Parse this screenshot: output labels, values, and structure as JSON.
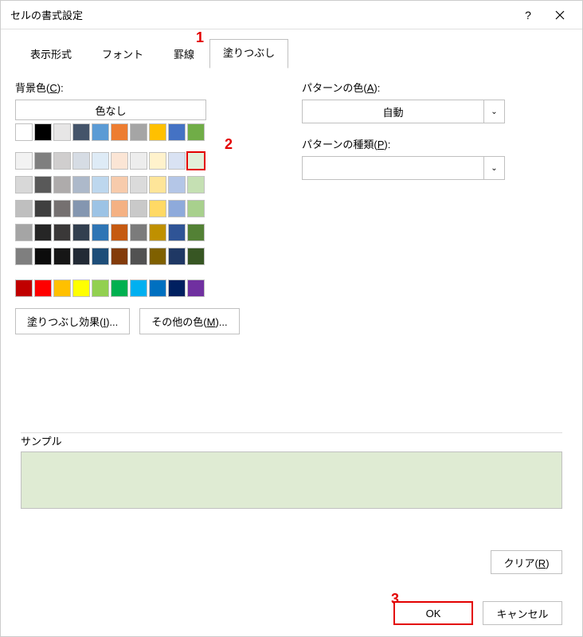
{
  "dialog": {
    "title": "セルの書式設定"
  },
  "tabs": {
    "display_format": "表示形式",
    "font": "フォント",
    "border": "罫線",
    "fill": "塗りつぶし"
  },
  "annotations": {
    "one": "1",
    "two": "2",
    "three": "3"
  },
  "left": {
    "bg_label_pre": "背景色(",
    "bg_label_u": "C",
    "bg_label_post": "):",
    "no_color": "色なし",
    "fill_effects_pre": "塗りつぶし効果(",
    "fill_effects_u": "I",
    "fill_effects_post": ")...",
    "other_colors_pre": "その他の色(",
    "other_colors_u": "M",
    "other_colors_post": ")..."
  },
  "right": {
    "pattern_color_pre": "パターンの色(",
    "pattern_color_u": "A",
    "pattern_color_post": "):",
    "pattern_color_value": "自動",
    "pattern_type_pre": "パターンの種類(",
    "pattern_type_u": "P",
    "pattern_type_post": "):",
    "pattern_type_value": ""
  },
  "sample": {
    "label": "サンプル",
    "color": "#dfebd3"
  },
  "buttons": {
    "clear_pre": "クリア(",
    "clear_u": "R",
    "clear_post": ")",
    "ok": "OK",
    "cancel": "キャンセル"
  },
  "colors": {
    "row1": [
      "#ffffff",
      "#000000",
      "#e7e6e6",
      "#44546a",
      "#5b9bd5",
      "#ed7d31",
      "#a5a5a5",
      "#ffc000",
      "#4472c4",
      "#70ad47"
    ],
    "grid": [
      [
        "#f2f2f2",
        "#7f7f7f",
        "#d0cece",
        "#d6dce4",
        "#deebf6",
        "#fbe5d5",
        "#ededed",
        "#fff2cc",
        "#d9e2f3",
        "#e2efd9"
      ],
      [
        "#d8d8d8",
        "#595959",
        "#aeabab",
        "#adb9ca",
        "#bdd7ee",
        "#f7cbac",
        "#dbdbdb",
        "#fee599",
        "#b4c6e7",
        "#c5e0b3"
      ],
      [
        "#bfbfbf",
        "#3f3f3f",
        "#757070",
        "#8496b0",
        "#9cc3e5",
        "#f4b183",
        "#c9c9c9",
        "#ffd965",
        "#8eaadb",
        "#a8d08d"
      ],
      [
        "#a5a5a5",
        "#262626",
        "#3a3838",
        "#323f4f",
        "#2e75b5",
        "#c55a11",
        "#7b7b7b",
        "#bf9000",
        "#2f5496",
        "#538135"
      ],
      [
        "#7f7f7f",
        "#0c0c0c",
        "#161616",
        "#222a35",
        "#1e4e79",
        "#833c0b",
        "#525252",
        "#7f6000",
        "#1f3864",
        "#375623"
      ]
    ],
    "standard": [
      "#c00000",
      "#ff0000",
      "#ffc000",
      "#ffff00",
      "#92d050",
      "#00b050",
      "#00b0f0",
      "#0070c0",
      "#002060",
      "#7030a0"
    ],
    "selected_index": {
      "row": 0,
      "col": 9
    }
  }
}
